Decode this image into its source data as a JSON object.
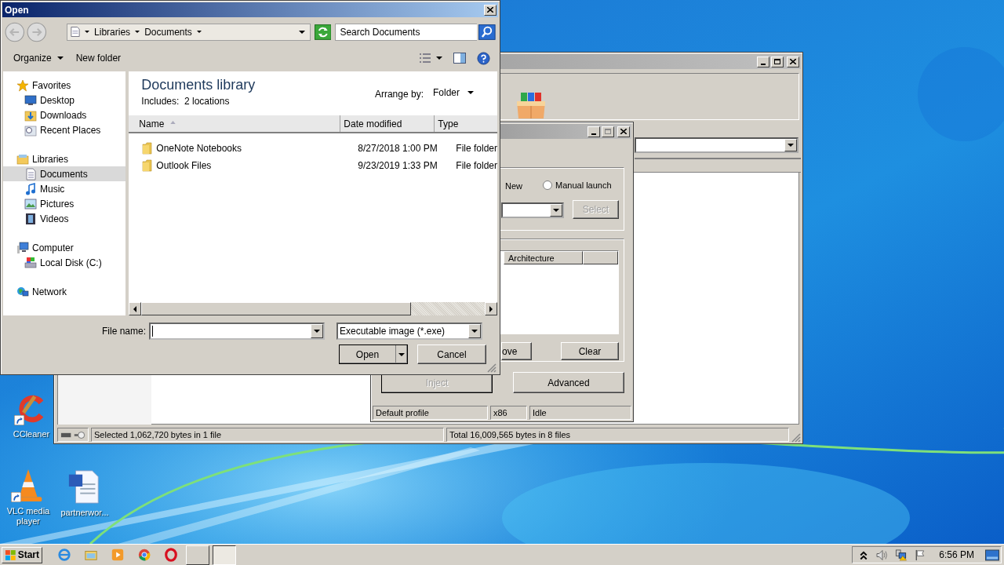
{
  "open_dialog": {
    "title": "Open",
    "breadcrumb": [
      "Libraries",
      "Documents"
    ],
    "search": {
      "placeholder": "Search Documents"
    },
    "toolbar": [
      {
        "label": "Organize",
        "menu": true
      },
      {
        "label": "New folder",
        "menu": false
      }
    ],
    "nav": [
      {
        "label": "Favorites",
        "selected": false,
        "children": [
          {
            "label": "Desktop",
            "selected": false
          },
          {
            "label": "Downloads",
            "selected": false
          },
          {
            "label": "Recent Places",
            "selected": false
          }
        ]
      },
      {
        "label": "Libraries",
        "selected": false,
        "children": [
          {
            "label": "Documents",
            "selected": true
          },
          {
            "label": "Music",
            "selected": false
          },
          {
            "label": "Pictures",
            "selected": false
          },
          {
            "label": "Videos",
            "selected": false
          }
        ]
      },
      {
        "label": "Computer",
        "selected": false,
        "children": [
          {
            "label": "Local Disk (C:)",
            "selected": false
          }
        ]
      },
      {
        "label": "Network",
        "selected": false
      }
    ],
    "library": {
      "title": "Documents library",
      "includes_label": "Includes:",
      "includes_value": "2 locations",
      "arrange_label": "Arrange by:",
      "arrange_value": "Folder"
    },
    "columns": [
      {
        "label": "Name",
        "sorted": true
      },
      {
        "label": "Date modified",
        "sorted": false
      },
      {
        "label": "Type",
        "sorted": false
      }
    ],
    "rows": [
      {
        "name": "OneNote Notebooks",
        "date": "8/27/2018 1:00 PM",
        "type": "File folder"
      },
      {
        "name": "Outlook Files",
        "date": "9/23/2019 1:33 PM",
        "type": "File folder"
      }
    ],
    "file_name_label": "File name:",
    "file_type": "Executable image (*.exe)",
    "open_button": "Open",
    "cancel_button": "Cancel"
  },
  "main_window": {
    "status": [
      "Selected 1,062,720 bytes in 1 file",
      "Total 16,009,565 bytes in 8 files"
    ]
  },
  "injector": {
    "new_label": "New",
    "manual_launch": {
      "label": "Manual launch",
      "selected": false
    },
    "select_button": {
      "label": "Select",
      "disabled": true
    },
    "list_column": "Architecture",
    "remove_button": "ove",
    "clear_button": "Clear",
    "inject_button": {
      "label": "Inject",
      "disabled": true
    },
    "advanced_button": {
      "label": "Advanced",
      "disabled": false
    },
    "status": [
      "Default profile",
      "x86",
      "Idle"
    ]
  },
  "desktop_icons": [
    {
      "label": "CCleaner",
      "shortcut": true
    },
    {
      "label": "VLC media player",
      "shortcut": true
    },
    {
      "label": "partnerwor...",
      "shortcut": false
    }
  ],
  "taskbar": {
    "start": "Start",
    "apps": [
      {
        "open": false,
        "selected": false
      },
      {
        "open": false,
        "selected": false
      },
      {
        "open": false,
        "selected": false
      },
      {
        "open": false,
        "selected": false
      },
      {
        "open": false,
        "selected": false
      },
      {
        "open": true,
        "selected": false
      },
      {
        "open": true,
        "selected": true
      }
    ],
    "clock": "6:56 PM"
  }
}
